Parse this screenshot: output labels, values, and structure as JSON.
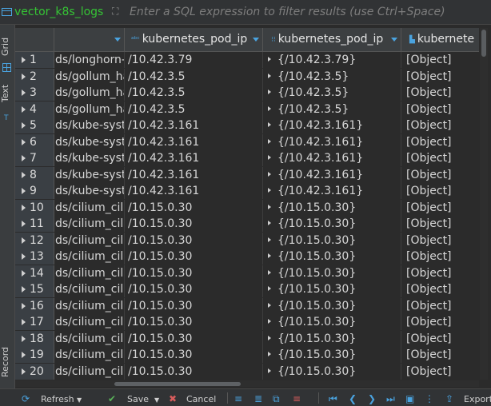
{
  "toolbar_top": {
    "table_name": "vector_k8s_logs",
    "filter_placeholder": "Enter a SQL expression to filter results (use Ctrl+Space)"
  },
  "side_tabs": {
    "grid": "Grid",
    "text": "Text",
    "record": "Record"
  },
  "columns": [
    {
      "label": "",
      "icon": ""
    },
    {
      "label": "kubernetes_pod_ip",
      "icon": "abc"
    },
    {
      "label": "kubernetes_pod_ip",
      "icon": "array-grid"
    },
    {
      "label": "kubernete",
      "icon": "struct"
    }
  ],
  "rows": [
    {
      "num": "1",
      "c1": "ds/longhorn-s",
      "c2": "/10.42.3.79",
      "c3": "{/10.42.3.79}",
      "c4": "[Object]"
    },
    {
      "num": "2",
      "c1": "ds/gollum_ha",
      "c2": "/10.42.3.5",
      "c3": "{/10.42.3.5}",
      "c4": "[Object]"
    },
    {
      "num": "3",
      "c1": "ds/gollum_ha",
      "c2": "/10.42.3.5",
      "c3": "{/10.42.3.5}",
      "c4": "[Object]"
    },
    {
      "num": "4",
      "c1": "ds/gollum_ha",
      "c2": "/10.42.3.5",
      "c3": "{/10.42.3.5}",
      "c4": "[Object]"
    },
    {
      "num": "5",
      "c1": "ds/kube-syste",
      "c2": "/10.42.3.161",
      "c3": "{/10.42.3.161}",
      "c4": "[Object]"
    },
    {
      "num": "6",
      "c1": "ds/kube-syste",
      "c2": "/10.42.3.161",
      "c3": "{/10.42.3.161}",
      "c4": "[Object]"
    },
    {
      "num": "7",
      "c1": "ds/kube-syste",
      "c2": "/10.42.3.161",
      "c3": "{/10.42.3.161}",
      "c4": "[Object]"
    },
    {
      "num": "8",
      "c1": "ds/kube-syste",
      "c2": "/10.42.3.161",
      "c3": "{/10.42.3.161}",
      "c4": "[Object]"
    },
    {
      "num": "9",
      "c1": "ds/kube-syste",
      "c2": "/10.42.3.161",
      "c3": "{/10.42.3.161}",
      "c4": "[Object]"
    },
    {
      "num": "10",
      "c1": "ds/cilium_cilii",
      "c2": "/10.15.0.30",
      "c3": "{/10.15.0.30}",
      "c4": "[Object]"
    },
    {
      "num": "11",
      "c1": "ds/cilium_cilii",
      "c2": "/10.15.0.30",
      "c3": "{/10.15.0.30}",
      "c4": "[Object]"
    },
    {
      "num": "12",
      "c1": "ds/cilium_cilii",
      "c2": "/10.15.0.30",
      "c3": "{/10.15.0.30}",
      "c4": "[Object]"
    },
    {
      "num": "13",
      "c1": "ds/cilium_cilii",
      "c2": "/10.15.0.30",
      "c3": "{/10.15.0.30}",
      "c4": "[Object]"
    },
    {
      "num": "14",
      "c1": "ds/cilium_cilii",
      "c2": "/10.15.0.30",
      "c3": "{/10.15.0.30}",
      "c4": "[Object]"
    },
    {
      "num": "15",
      "c1": "ds/cilium_cilii",
      "c2": "/10.15.0.30",
      "c3": "{/10.15.0.30}",
      "c4": "[Object]"
    },
    {
      "num": "16",
      "c1": "ds/cilium_cilii",
      "c2": "/10.15.0.30",
      "c3": "{/10.15.0.30}",
      "c4": "[Object]"
    },
    {
      "num": "17",
      "c1": "ds/cilium_cilii",
      "c2": "/10.15.0.30",
      "c3": "{/10.15.0.30}",
      "c4": "[Object]"
    },
    {
      "num": "18",
      "c1": "ds/cilium_cilii",
      "c2": "/10.15.0.30",
      "c3": "{/10.15.0.30}",
      "c4": "[Object]"
    },
    {
      "num": "19",
      "c1": "ds/cilium_cilii",
      "c2": "/10.15.0.30",
      "c3": "{/10.15.0.30}",
      "c4": "[Object]"
    },
    {
      "num": "20",
      "c1": "ds/cilium_cilii",
      "c2": "/10.15.0.30",
      "c3": "{/10.15.0.30}",
      "c4": "[Object]"
    }
  ],
  "bottom_toolbar": {
    "refresh": "Refresh",
    "save": "Save",
    "cancel": "Cancel",
    "export": "Export"
  },
  "colors": {
    "accent": "#4aa3df",
    "table_name": "#35c435",
    "background": "#2b2b2b"
  }
}
